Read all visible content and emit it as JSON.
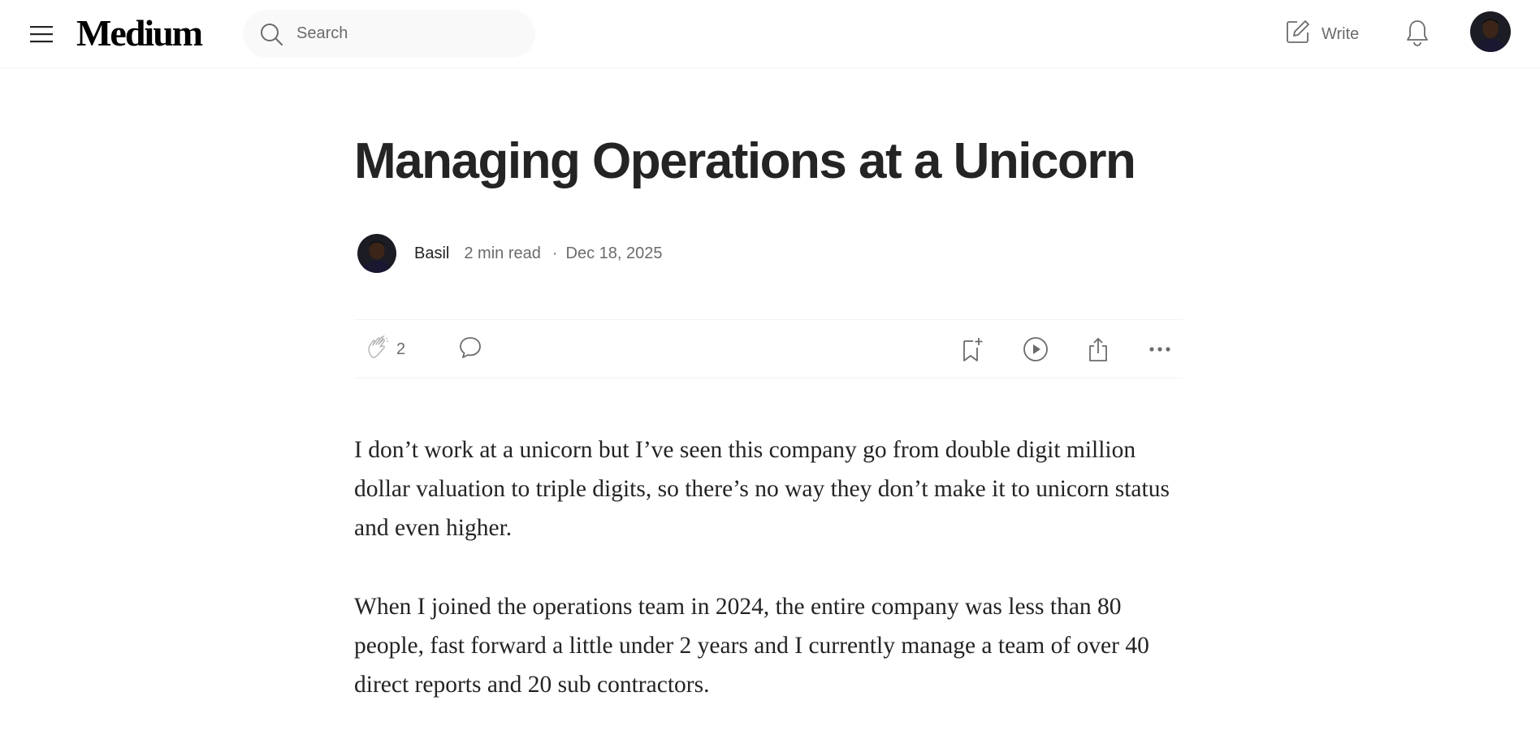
{
  "header": {
    "logo": "Medium",
    "search_placeholder": "Search",
    "write_label": "Write"
  },
  "article": {
    "title": "Managing Operations at a Unicorn",
    "author": "Basil",
    "read_time": "2 min read",
    "separator": "·",
    "date": "Dec 18, 2025",
    "claps": "2",
    "paragraphs": [
      "I don’t work at a unicorn but I’ve seen this company go from double digit million dollar valuation to triple digits, so there’s no way they don’t make it to unicorn status and even higher.",
      "When I joined the operations team in 2024, the entire company was less than 80 people, fast forward a little under 2 years and I currently manage a team of over 40 direct reports and 20 sub contractors."
    ]
  },
  "icons": {
    "menu": "menu-icon",
    "search": "search-icon",
    "write": "pencil-square-icon",
    "notifications": "bell-icon",
    "clap": "clap-icon",
    "comment": "speech-bubble-icon",
    "save": "bookmark-plus-icon",
    "listen": "play-circle-icon",
    "share": "share-icon",
    "more": "more-dots-icon"
  },
  "colors": {
    "text_primary": "#242424",
    "text_secondary": "#6b6b6b",
    "search_bg": "#f9f9f9",
    "divider": "#f2f2f2"
  }
}
